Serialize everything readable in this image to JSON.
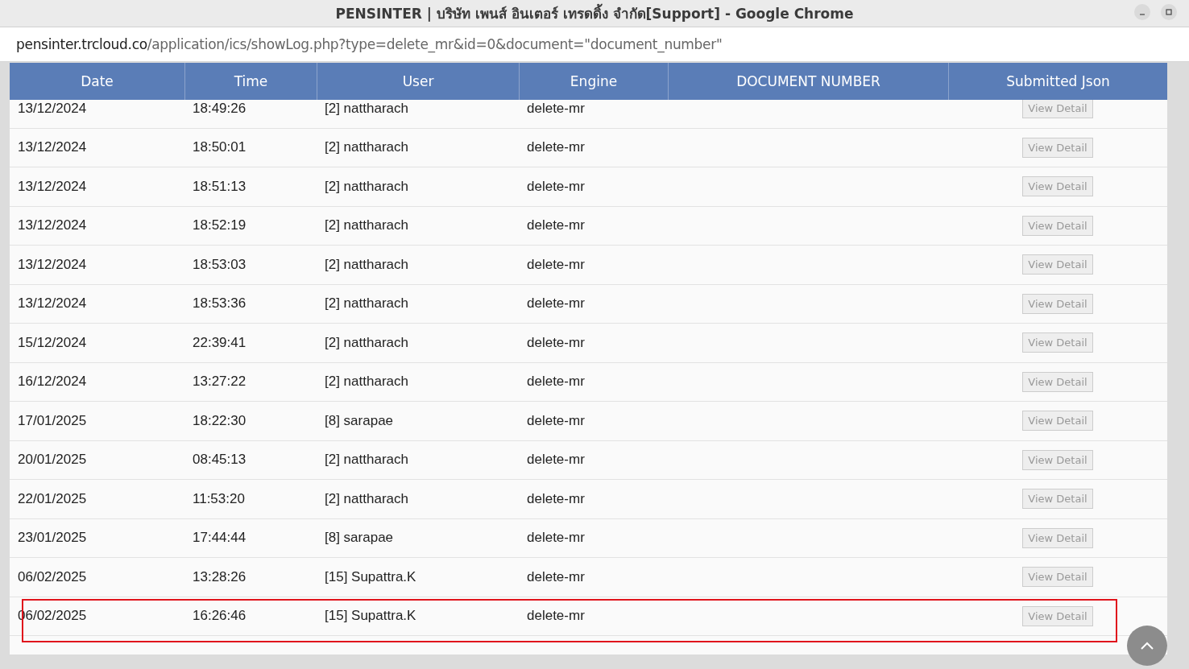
{
  "window": {
    "title": "PENSINTER | บริษัท เพนส์ อินเตอร์ เทรดดิ้ง จำกัด[Support] - Google Chrome"
  },
  "address_bar": {
    "host": "pensinter.trcloud.co",
    "path": "/application/ics/showLog.php?type=delete_mr&id=0&document=\"document_number\""
  },
  "table": {
    "columns": [
      "Date",
      "Time",
      "User",
      "Engine",
      "DOCUMENT NUMBER",
      "Submitted Json"
    ],
    "rows": [
      {
        "date": "13/12/2024",
        "time": "18:49:26",
        "user": "[2] nattharach",
        "engine": "delete-mr",
        "action": "View Detail",
        "highlighted": false
      },
      {
        "date": "13/12/2024",
        "time": "18:50:01",
        "user": "[2] nattharach",
        "engine": "delete-mr",
        "action": "View Detail",
        "highlighted": false
      },
      {
        "date": "13/12/2024",
        "time": "18:51:13",
        "user": "[2] nattharach",
        "engine": "delete-mr",
        "action": "View Detail",
        "highlighted": false
      },
      {
        "date": "13/12/2024",
        "time": "18:52:19",
        "user": "[2] nattharach",
        "engine": "delete-mr",
        "action": "View Detail",
        "highlighted": false
      },
      {
        "date": "13/12/2024",
        "time": "18:53:03",
        "user": "[2] nattharach",
        "engine": "delete-mr",
        "action": "View Detail",
        "highlighted": false
      },
      {
        "date": "13/12/2024",
        "time": "18:53:36",
        "user": "[2] nattharach",
        "engine": "delete-mr",
        "action": "View Detail",
        "highlighted": false
      },
      {
        "date": "15/12/2024",
        "time": "22:39:41",
        "user": "[2] nattharach",
        "engine": "delete-mr",
        "action": "View Detail",
        "highlighted": false
      },
      {
        "date": "16/12/2024",
        "time": "13:27:22",
        "user": "[2] nattharach",
        "engine": "delete-mr",
        "action": "View Detail",
        "highlighted": false
      },
      {
        "date": "17/01/2025",
        "time": "18:22:30",
        "user": "[8] sarapae",
        "engine": "delete-mr",
        "action": "View Detail",
        "highlighted": false
      },
      {
        "date": "20/01/2025",
        "time": "08:45:13",
        "user": "[2] nattharach",
        "engine": "delete-mr",
        "action": "View Detail",
        "highlighted": false
      },
      {
        "date": "22/01/2025",
        "time": "11:53:20",
        "user": "[2] nattharach",
        "engine": "delete-mr",
        "action": "View Detail",
        "highlighted": false
      },
      {
        "date": "23/01/2025",
        "time": "17:44:44",
        "user": "[8] sarapae",
        "engine": "delete-mr",
        "action": "View Detail",
        "highlighted": false
      },
      {
        "date": "06/02/2025",
        "time": "13:28:26",
        "user": "[15] Supattra.K",
        "engine": "delete-mr",
        "action": "View Detail",
        "highlighted": false
      },
      {
        "date": "06/02/2025",
        "time": "16:26:46",
        "user": "[15] Supattra.K",
        "engine": "delete-mr",
        "action": "View Detail",
        "highlighted": true
      }
    ]
  }
}
